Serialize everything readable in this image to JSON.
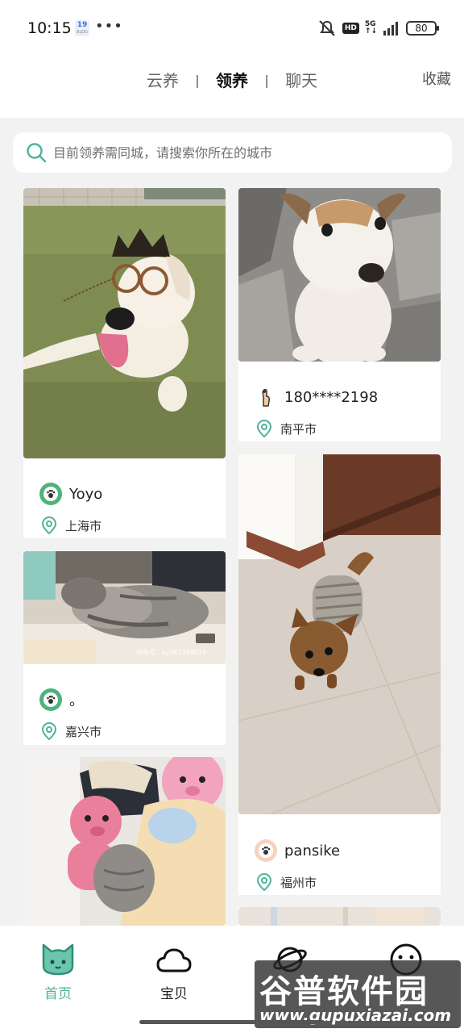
{
  "status_bar": {
    "time": "10:15",
    "calendar_day": "19",
    "calendar_caption": "BLOG",
    "dots": "•••",
    "hd": "HD",
    "network": "5G",
    "battery": "80"
  },
  "top_nav": {
    "tabs": [
      {
        "label": "云养"
      },
      {
        "label": "领养"
      },
      {
        "label": "聊天"
      }
    ],
    "active_tab": "领养",
    "separator": "|",
    "favorites": "收藏"
  },
  "search": {
    "placeholder": "目前领养需同城，请搜索你所在的城市"
  },
  "cards": [
    {
      "user": "Yoyo",
      "city": "上海市",
      "image": "dog-with-crown"
    },
    {
      "user": "180****2198",
      "city": "南平市",
      "image": "puppy"
    },
    {
      "user": "。",
      "city": "嘉兴市",
      "image": "sleeping-cat",
      "image_text": "闲鱼号：xy262169019"
    },
    {
      "user": "pansike",
      "city": "福州市",
      "image": "yorkie"
    },
    {
      "user": "",
      "city": "",
      "image": "cat-with-toys"
    }
  ],
  "bottom_nav": {
    "items": [
      {
        "label": "首页",
        "icon": "cat-face-icon"
      },
      {
        "label": "宝贝",
        "icon": "cloud-icon"
      },
      {
        "label": "",
        "icon": "planet-icon"
      },
      {
        "label": "",
        "icon": "smile-face-icon"
      }
    ]
  },
  "watermark": {
    "title": "谷普软件园",
    "url": "www.gupuxiazai.com"
  },
  "colors": {
    "accent": "#4db39a",
    "background": "#f2f2f2"
  }
}
